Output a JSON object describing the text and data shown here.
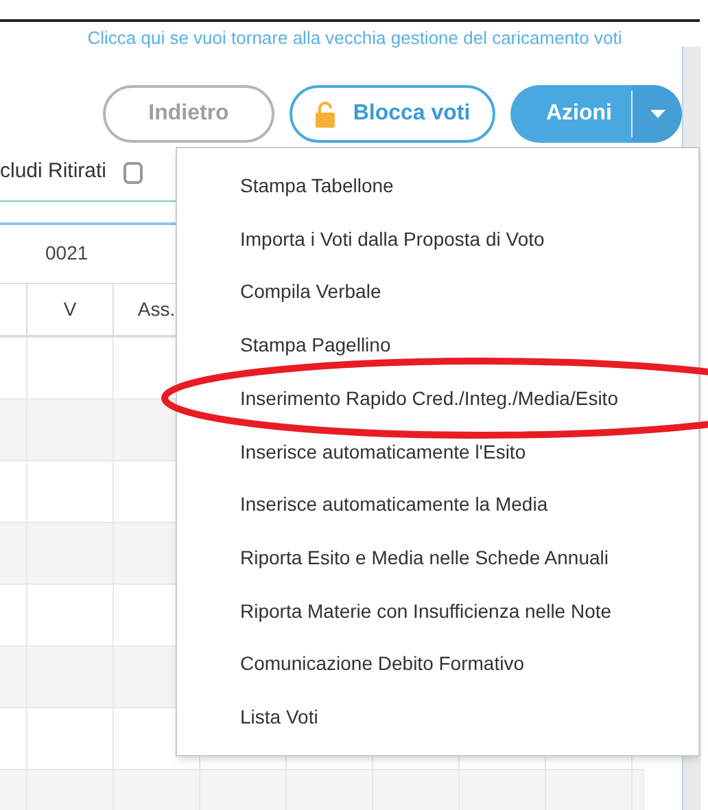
{
  "link": "Clicca qui se vuoi tornare alla vecchia gestione del caricamento voti",
  "buttons": [
    {
      "label": "Indietro",
      "kind": "secondary"
    },
    {
      "label": "Blocca voti",
      "kind": "lock"
    },
    {
      "label": "Azioni",
      "kind": "split",
      "expanded": true
    }
  ],
  "filter": {
    "label": "cludi Ritirati",
    "checked": false
  },
  "table": {
    "group_header": "0021",
    "columns": [
      "V",
      "Ass."
    ]
  },
  "actions_menu": {
    "items": [
      "Stampa Tabellone",
      "Importa i Voti dalla Proposta di Voto",
      "Compila Verbale",
      "Stampa Pagellino",
      "Inserimento Rapido Cred./Integ./Media/Esito",
      "Inserisce automaticamente l'Esito",
      "Inserisce automaticamente la Media",
      "Riporta Esito e Media nelle Schede Annuali",
      "Riporta Materie con Insufficienza nelle Note",
      "Comunicazione Debito Formativo",
      "Lista Voti"
    ]
  }
}
